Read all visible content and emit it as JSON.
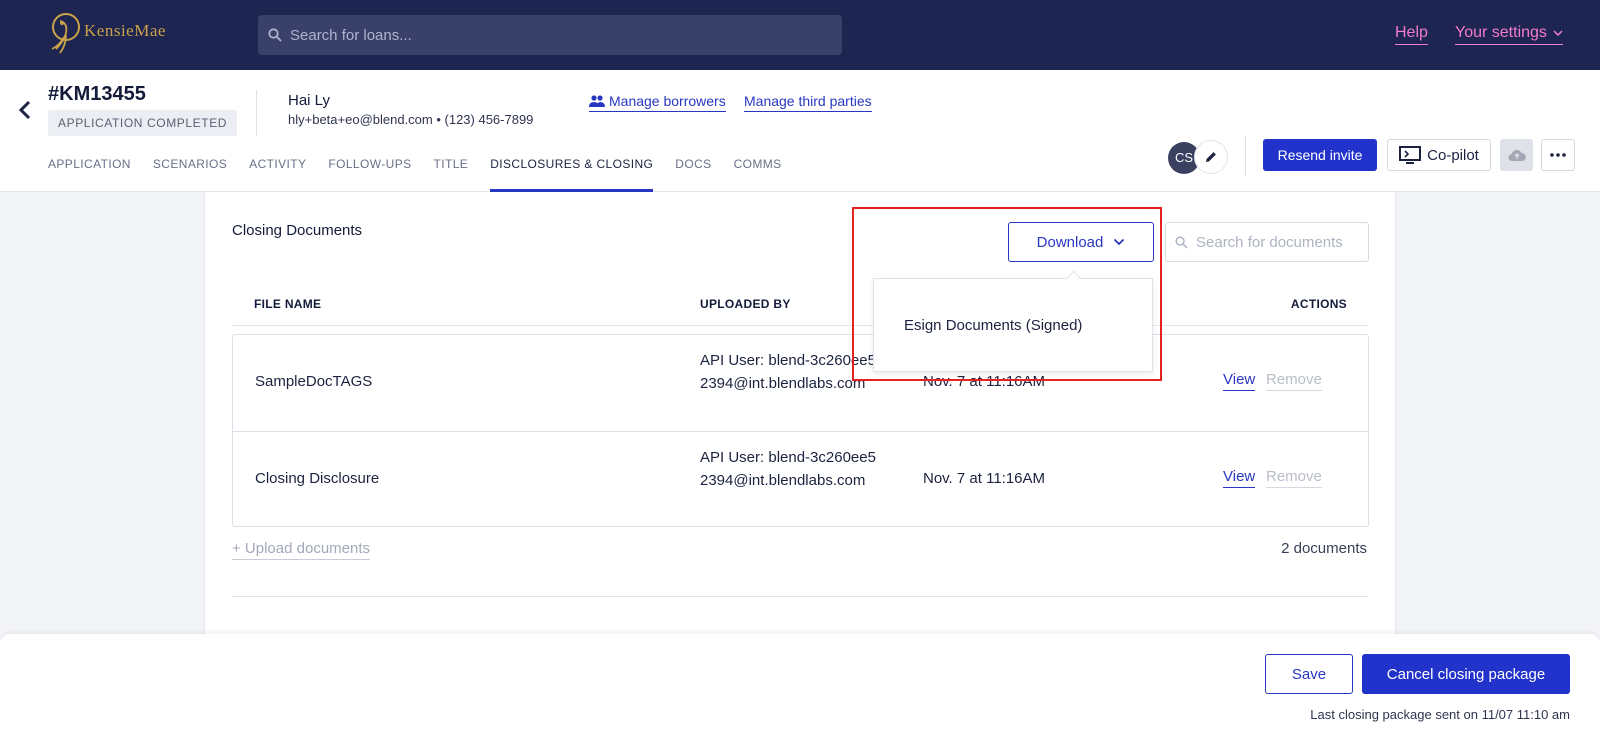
{
  "topnav": {
    "logo_text": "KensieMae",
    "search_placeholder": "Search for loans...",
    "help_label": "Help",
    "settings_label": "Your settings"
  },
  "header": {
    "loan_id": "#KM13455",
    "status": "APPLICATION COMPLETED",
    "borrower_name": "Hai Ly",
    "borrower_contact": "hly+beta+eo@blend.com • (123) 456-7899",
    "manage_borrowers": "Manage borrowers",
    "manage_third_parties": "Manage third parties",
    "avatar_initials": "CS",
    "resend_label": "Resend invite",
    "copilot_label": "Co-pilot"
  },
  "tabs": [
    {
      "label": "APPLICATION"
    },
    {
      "label": "SCENARIOS"
    },
    {
      "label": "ACTIVITY"
    },
    {
      "label": "FOLLOW-UPS"
    },
    {
      "label": "TITLE"
    },
    {
      "label": "DISCLOSURES & CLOSING",
      "active": true
    },
    {
      "label": "DOCS"
    },
    {
      "label": "COMMS"
    }
  ],
  "main": {
    "section_title": "Closing Documents",
    "download_label": "Download",
    "doc_search_placeholder": "Search for documents",
    "dropdown_item": "Esign Documents (Signed)",
    "columns": {
      "file_name": "FILE NAME",
      "uploaded_by": "UPLOADED BY",
      "actions": "ACTIONS"
    },
    "rows": [
      {
        "name": "SampleDocTAGS",
        "uploaded_by": "API User: blend-3c260ee52394@int.blendlabs.com",
        "date": "Nov. 7 at 11:16AM",
        "view": "View",
        "remove": "Remove"
      },
      {
        "name": "Closing Disclosure",
        "uploaded_by": "API User: blend-3c260ee52394@int.blendlabs.com",
        "date": "Nov. 7 at 11:16AM",
        "view": "View",
        "remove": "Remove"
      }
    ],
    "upload_label": "+ Upload documents",
    "doc_count": "2 documents"
  },
  "footer": {
    "save_label": "Save",
    "cancel_label": "Cancel closing package",
    "last_sent": "Last closing package sent on 11/07 11:10 am"
  },
  "colors": {
    "nav_bg": "#1d2550",
    "accent": "#2233cc",
    "link_pink": "#f27ad0",
    "highlight": "#e32222"
  }
}
